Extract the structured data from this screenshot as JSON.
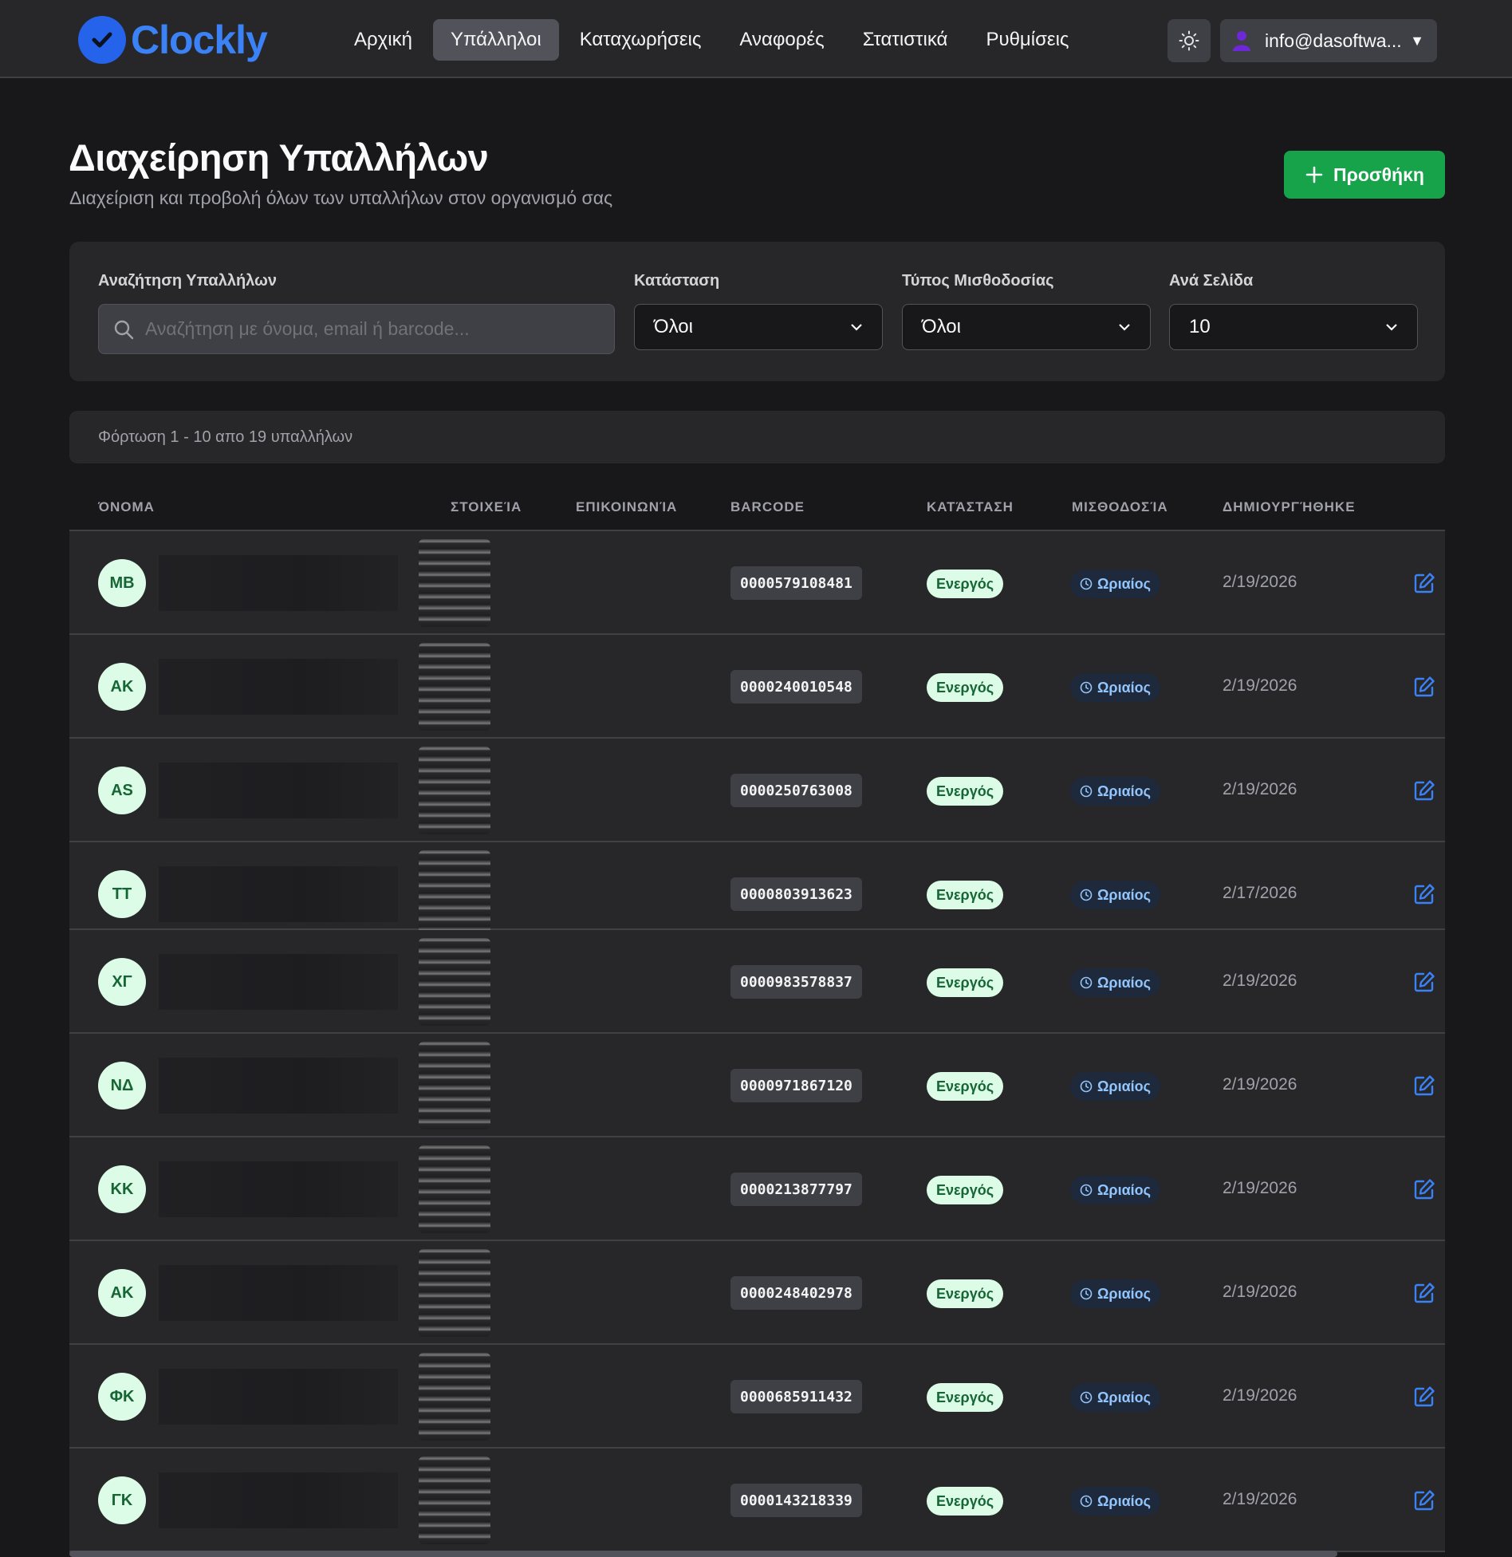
{
  "app": {
    "name": "Clockly",
    "brand_color": "#3b82f6",
    "accent_color": "#16a34a"
  },
  "nav": {
    "items": [
      {
        "label": "Αρχική",
        "active": false
      },
      {
        "label": "Υπάλληλοι",
        "active": true
      },
      {
        "label": "Καταχωρήσεις",
        "active": false
      },
      {
        "label": "Αναφορές",
        "active": false
      },
      {
        "label": "Στατιστικά",
        "active": false
      },
      {
        "label": "Ρυθμίσεις",
        "active": false
      }
    ],
    "theme_icon": "sun-icon",
    "user_email": "info@dasoftwa...",
    "user_caret": "▼"
  },
  "header": {
    "title": "Διαχείρηση Υπαλλήλων",
    "subtitle": "Διαχείριση και προβολή όλων των υπαλλήλων στον οργανισμό σας",
    "add_button": "Προσθήκη"
  },
  "filters": {
    "search_label": "Αναζήτηση Υπαλλήλων",
    "search_placeholder": "Αναζήτηση με όνομα, email ή barcode...",
    "status_label": "Κατάσταση",
    "status_value": "Όλοι",
    "payroll_label": "Τύπος Μισθοδοσίας",
    "payroll_value": "Όλοι",
    "per_page_label": "Ανά Σελίδα",
    "per_page_value": "10"
  },
  "info": {
    "loading_text": "Φόρτωση 1 - 10 απο 19 υπαλλήλων"
  },
  "table": {
    "columns": [
      "ΌΝΟΜΑ",
      "ΣΤΟΙΧΕΊΑ",
      "ΕΠΙΚΟΙΝΩΝΊΑ",
      "BARCODE",
      "ΚΑΤΆΣΤΑΣΗ",
      "ΜΙΣΘΟΔΟΣΊΑ",
      "ΔΗΜΙΟΥΡΓΉΘΗΚΕ"
    ],
    "rows": [
      {
        "initials": "MB",
        "barcode": "0000579108481",
        "status": "Ενεργός",
        "payroll": "Ωριαίος",
        "created": "2/19/2026"
      },
      {
        "initials": "AK",
        "barcode": "0000240010548",
        "status": "Ενεργός",
        "payroll": "Ωριαίος",
        "created": "2/19/2026"
      },
      {
        "initials": "AS",
        "barcode": "0000250763008",
        "status": "Ενεργός",
        "payroll": "Ωριαίος",
        "created": "2/19/2026"
      },
      {
        "initials": "TT",
        "barcode": "0000803913623",
        "status": "Ενεργός",
        "payroll": "Ωριαίος",
        "created": "2/17/2026"
      },
      {
        "initials": "ΧΓ",
        "barcode": "0000983578837",
        "status": "Ενεργός",
        "payroll": "Ωριαίος",
        "created": "2/19/2026"
      },
      {
        "initials": "ΝΔ",
        "barcode": "0000971867120",
        "status": "Ενεργός",
        "payroll": "Ωριαίος",
        "created": "2/19/2026"
      },
      {
        "initials": "ΚΚ",
        "barcode": "0000213877797",
        "status": "Ενεργός",
        "payroll": "Ωριαίος",
        "created": "2/19/2026"
      },
      {
        "initials": "AK",
        "barcode": "0000248402978",
        "status": "Ενεργός",
        "payroll": "Ωριαίος",
        "created": "2/19/2026"
      },
      {
        "initials": "ΦΚ",
        "barcode": "0000685911432",
        "status": "Ενεργός",
        "payroll": "Ωριαίος",
        "created": "2/19/2026"
      },
      {
        "initials": "ΓΚ",
        "barcode": "0000143218339",
        "status": "Ενεργός",
        "payroll": "Ωριαίος",
        "created": "2/19/2026"
      }
    ]
  }
}
